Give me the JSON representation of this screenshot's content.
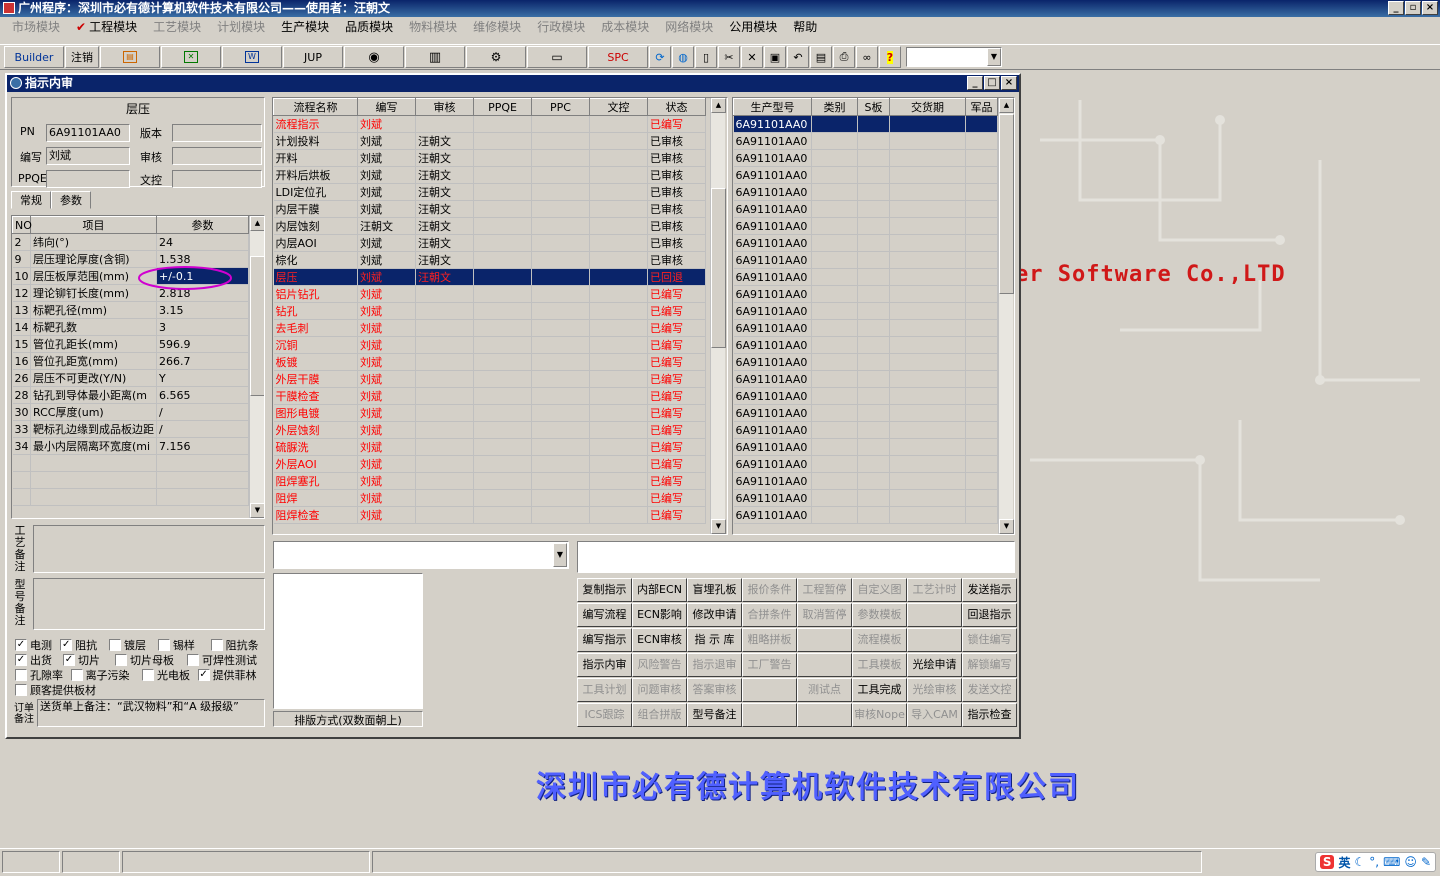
{
  "app": {
    "title": "广州程序：深圳市必有德计算机软件技术有限公司——使用者：汪朝文",
    "window_buttons": [
      "_",
      "▫",
      "×"
    ]
  },
  "menu": [
    {
      "label": "市场模块",
      "enabled": false,
      "checked": false
    },
    {
      "label": "工程模块",
      "enabled": true,
      "checked": true
    },
    {
      "label": "工艺模块",
      "enabled": false,
      "checked": false
    },
    {
      "label": "计划模块",
      "enabled": false,
      "checked": false
    },
    {
      "label": "生产模块",
      "enabled": true,
      "checked": false
    },
    {
      "label": "品质模块",
      "enabled": true,
      "checked": false
    },
    {
      "label": "物料模块",
      "enabled": false,
      "checked": false
    },
    {
      "label": "维修模块",
      "enabled": false,
      "checked": false
    },
    {
      "label": "行政模块",
      "enabled": false,
      "checked": false
    },
    {
      "label": "成本模块",
      "enabled": false,
      "checked": false
    },
    {
      "label": "网络模块",
      "enabled": false,
      "checked": false
    },
    {
      "label": "公用模块",
      "enabled": true,
      "checked": false
    },
    {
      "label": "帮助",
      "enabled": true,
      "checked": false
    }
  ],
  "toolbar": {
    "builder": "Builder",
    "logout": "注销",
    "jup": "JUP",
    "spc": "SPC",
    "word_icon": "W"
  },
  "background": {
    "software_text": "er Software Co.,LTD",
    "company_text": "深圳市必有德计算机软件技术有限公司"
  },
  "dialog": {
    "title": "指示内审",
    "process_name": "层压",
    "pn_label": "PN",
    "pn_value": "6A91101AA0",
    "version_label": "版本",
    "version_value": "",
    "author_label": "编写",
    "author_value": "刘斌",
    "review_label": "审核",
    "review_value": "",
    "ppqe_label": "PPQE",
    "ppqe_value": "",
    "doc_label": "文控",
    "doc_value": "",
    "tabs": [
      "常规",
      "参数"
    ],
    "param_headers": [
      "NO",
      "项目",
      "参数"
    ],
    "params": [
      {
        "no": "2",
        "item": "纬向(°)",
        "value": "24"
      },
      {
        "no": "9",
        "item": "层压理论厚度(含铜)",
        "value": "1.538"
      },
      {
        "no": "10",
        "item": "层压板厚范围(mm)",
        "value": "+/-0.1"
      },
      {
        "no": "12",
        "item": "理论铆钉长度(mm)",
        "value": "2.818"
      },
      {
        "no": "13",
        "item": "标靶孔径(mm)",
        "value": "3.15"
      },
      {
        "no": "14",
        "item": "标靶孔数",
        "value": "3"
      },
      {
        "no": "15",
        "item": "管位孔距长(mm)",
        "value": "596.9"
      },
      {
        "no": "16",
        "item": "管位孔距宽(mm)",
        "value": "266.7"
      },
      {
        "no": "26",
        "item": "层压不可更改(Y/N)",
        "value": "Y"
      },
      {
        "no": "28",
        "item": "钻孔到导体最小距离(m",
        "value": "6.565"
      },
      {
        "no": "30",
        "item": "RCC厚度(um)",
        "value": "/"
      },
      {
        "no": "33",
        "item": "靶标孔边缘到成品板边距",
        "value": "/"
      },
      {
        "no": "34",
        "item": "最小内层隔离环宽度(mi",
        "value": "7.156"
      }
    ],
    "process_note_label": "工艺备注",
    "model_note_label": "型号备注",
    "order_note_label": "订单备注",
    "order_note_value": "送货单上备注：“武汉物料”和“A 级报级”",
    "checkboxes": [
      {
        "label": "电测",
        "checked": true
      },
      {
        "label": "阻抗",
        "checked": true
      },
      {
        "label": "镀层",
        "checked": false
      },
      {
        "label": "锡样",
        "checked": false
      },
      {
        "label": "阻抗条",
        "checked": false
      },
      {
        "label": "出货",
        "checked": true
      },
      {
        "label": "切片",
        "checked": true
      },
      {
        "label": "切片母板",
        "checked": false
      },
      {
        "label": "可焊性测试",
        "checked": false
      },
      {
        "label": "孔隙率",
        "checked": false
      },
      {
        "label": "离子污染",
        "checked": false
      },
      {
        "label": "光电板",
        "checked": false
      },
      {
        "label": "提供菲林",
        "checked": true
      },
      {
        "label": "顾客提供板材",
        "checked": false
      }
    ],
    "flow_headers": [
      "流程名称",
      "编写",
      "审核",
      "PPQE",
      "PPC",
      "文控",
      "状态"
    ],
    "flows": [
      {
        "name": "流程指示",
        "author": "刘斌",
        "review": "",
        "status": "已编写",
        "style": "red"
      },
      {
        "name": "计划投料",
        "author": "刘斌",
        "review": "汪朝文",
        "status": "已审核",
        "style": "normal"
      },
      {
        "name": "开料",
        "author": "刘斌",
        "review": "汪朝文",
        "status": "已审核",
        "style": "normal"
      },
      {
        "name": "开料后烘板",
        "author": "刘斌",
        "review": "汪朝文",
        "status": "已审核",
        "style": "normal"
      },
      {
        "name": "LDI定位孔",
        "author": "刘斌",
        "review": "汪朝文",
        "status": "已审核",
        "style": "normal"
      },
      {
        "name": "内层干膜",
        "author": "刘斌",
        "review": "汪朝文",
        "status": "已审核",
        "style": "normal"
      },
      {
        "name": "内层蚀刻",
        "author": "汪朝文",
        "review": "汪朝文",
        "status": "已审核",
        "style": "normal"
      },
      {
        "name": "内层AOI",
        "author": "刘斌",
        "review": "汪朝文",
        "status": "已审核",
        "style": "normal"
      },
      {
        "name": "棕化",
        "author": "刘斌",
        "review": "汪朝文",
        "status": "已审核",
        "style": "normal"
      },
      {
        "name": "层压",
        "author": "刘斌",
        "review": "汪朝文",
        "status": "已回退",
        "style": "selected"
      },
      {
        "name": "铝片钻孔",
        "author": "刘斌",
        "review": "",
        "status": "已编写",
        "style": "red"
      },
      {
        "name": "钻孔",
        "author": "刘斌",
        "review": "",
        "status": "已编写",
        "style": "red"
      },
      {
        "name": "去毛刺",
        "author": "刘斌",
        "review": "",
        "status": "已编写",
        "style": "red"
      },
      {
        "name": "沉铜",
        "author": "刘斌",
        "review": "",
        "status": "已编写",
        "style": "red"
      },
      {
        "name": "板镀",
        "author": "刘斌",
        "review": "",
        "status": "已编写",
        "style": "red"
      },
      {
        "name": "外层干膜",
        "author": "刘斌",
        "review": "",
        "status": "已编写",
        "style": "red"
      },
      {
        "name": "干膜检查",
        "author": "刘斌",
        "review": "",
        "status": "已编写",
        "style": "red"
      },
      {
        "name": "图形电镀",
        "author": "刘斌",
        "review": "",
        "status": "已编写",
        "style": "red"
      },
      {
        "name": "外层蚀刻",
        "author": "刘斌",
        "review": "",
        "status": "已编写",
        "style": "red"
      },
      {
        "name": "硫脲洗",
        "author": "刘斌",
        "review": "",
        "status": "已编写",
        "style": "red"
      },
      {
        "name": "外层AOI",
        "author": "刘斌",
        "review": "",
        "status": "已编写",
        "style": "red"
      },
      {
        "name": "阻焊塞孔",
        "author": "刘斌",
        "review": "",
        "status": "已编写",
        "style": "red"
      },
      {
        "name": "阻焊",
        "author": "刘斌",
        "review": "",
        "status": "已编写",
        "style": "red"
      },
      {
        "name": "阻焊检查",
        "author": "刘斌",
        "review": "",
        "status": "已编写",
        "style": "red"
      }
    ],
    "model_headers": [
      "生产型号",
      "类别",
      "S板",
      "交货期",
      "军品"
    ],
    "models": [
      "6A91101AA0",
      "6A91101AA0",
      "6A91101AA0",
      "6A91101AA0",
      "6A91101AA0",
      "6A91101AA0",
      "6A91101AA0",
      "6A91101AA0",
      "6A91101AA0",
      "6A91101AA0",
      "6A91101AA0",
      "6A91101AA0",
      "6A91101AA0",
      "6A91101AA0",
      "6A91101AA0",
      "6A91101AA0",
      "6A91101AA0",
      "6A91101AA0",
      "6A91101AA0",
      "6A91101AA0",
      "6A91101AA0",
      "6A91101AA0",
      "6A91101AA0",
      "6A91101AA0"
    ],
    "sort_label": "排版方式(双数面朝上)",
    "buttons": [
      [
        {
          "label": "复制指示",
          "enabled": true
        },
        {
          "label": "内部ECN",
          "enabled": true
        },
        {
          "label": "盲埋孔板",
          "enabled": true
        },
        {
          "label": "报价条件",
          "enabled": false
        },
        {
          "label": "工程暂停",
          "enabled": false
        },
        {
          "label": "自定义图",
          "enabled": false
        },
        {
          "label": "工艺计时",
          "enabled": false
        },
        {
          "label": "发送指示",
          "enabled": true
        }
      ],
      [
        {
          "label": "编写流程",
          "enabled": true
        },
        {
          "label": "ECN影响",
          "enabled": true
        },
        {
          "label": "修改申请",
          "enabled": true
        },
        {
          "label": "合拼条件",
          "enabled": false
        },
        {
          "label": "取消暂停",
          "enabled": false
        },
        {
          "label": "参数模板",
          "enabled": false
        },
        {
          "label": "",
          "enabled": false
        },
        {
          "label": "回退指示",
          "enabled": true
        }
      ],
      [
        {
          "label": "编写指示",
          "enabled": true
        },
        {
          "label": "ECN审核",
          "enabled": true
        },
        {
          "label": "指 示 库",
          "enabled": true
        },
        {
          "label": "粗略拼板",
          "enabled": false
        },
        {
          "label": "",
          "enabled": false
        },
        {
          "label": "流程模板",
          "enabled": false
        },
        {
          "label": "",
          "enabled": false
        },
        {
          "label": "锁住编写",
          "enabled": false
        }
      ],
      [
        {
          "label": "指示内审",
          "enabled": true
        },
        {
          "label": "风险警告",
          "enabled": false
        },
        {
          "label": "指示退审",
          "enabled": false
        },
        {
          "label": "工厂警告",
          "enabled": false
        },
        {
          "label": "",
          "enabled": false
        },
        {
          "label": "工具模板",
          "enabled": false
        },
        {
          "label": "光绘申请",
          "enabled": true
        },
        {
          "label": "解锁编写",
          "enabled": false
        }
      ],
      [
        {
          "label": "工具计划",
          "enabled": false
        },
        {
          "label": "问题审核",
          "enabled": false
        },
        {
          "label": "答案审核",
          "enabled": false
        },
        {
          "label": "",
          "enabled": false
        },
        {
          "label": "测试点",
          "enabled": false
        },
        {
          "label": "工具完成",
          "enabled": true
        },
        {
          "label": "光绘审核",
          "enabled": false
        },
        {
          "label": "发送文控",
          "enabled": false
        }
      ],
      [
        {
          "label": "ICS跟踪",
          "enabled": false
        },
        {
          "label": "组合拼版",
          "enabled": false
        },
        {
          "label": "型号备注",
          "enabled": true
        },
        {
          "label": "",
          "enabled": false
        },
        {
          "label": "",
          "enabled": false
        },
        {
          "label": "审核Nope",
          "enabled": false
        },
        {
          "label": "导入CAM",
          "enabled": false
        },
        {
          "label": "指示检查",
          "enabled": true
        }
      ]
    ]
  },
  "ime": {
    "lang": "英",
    "logo": "S"
  }
}
